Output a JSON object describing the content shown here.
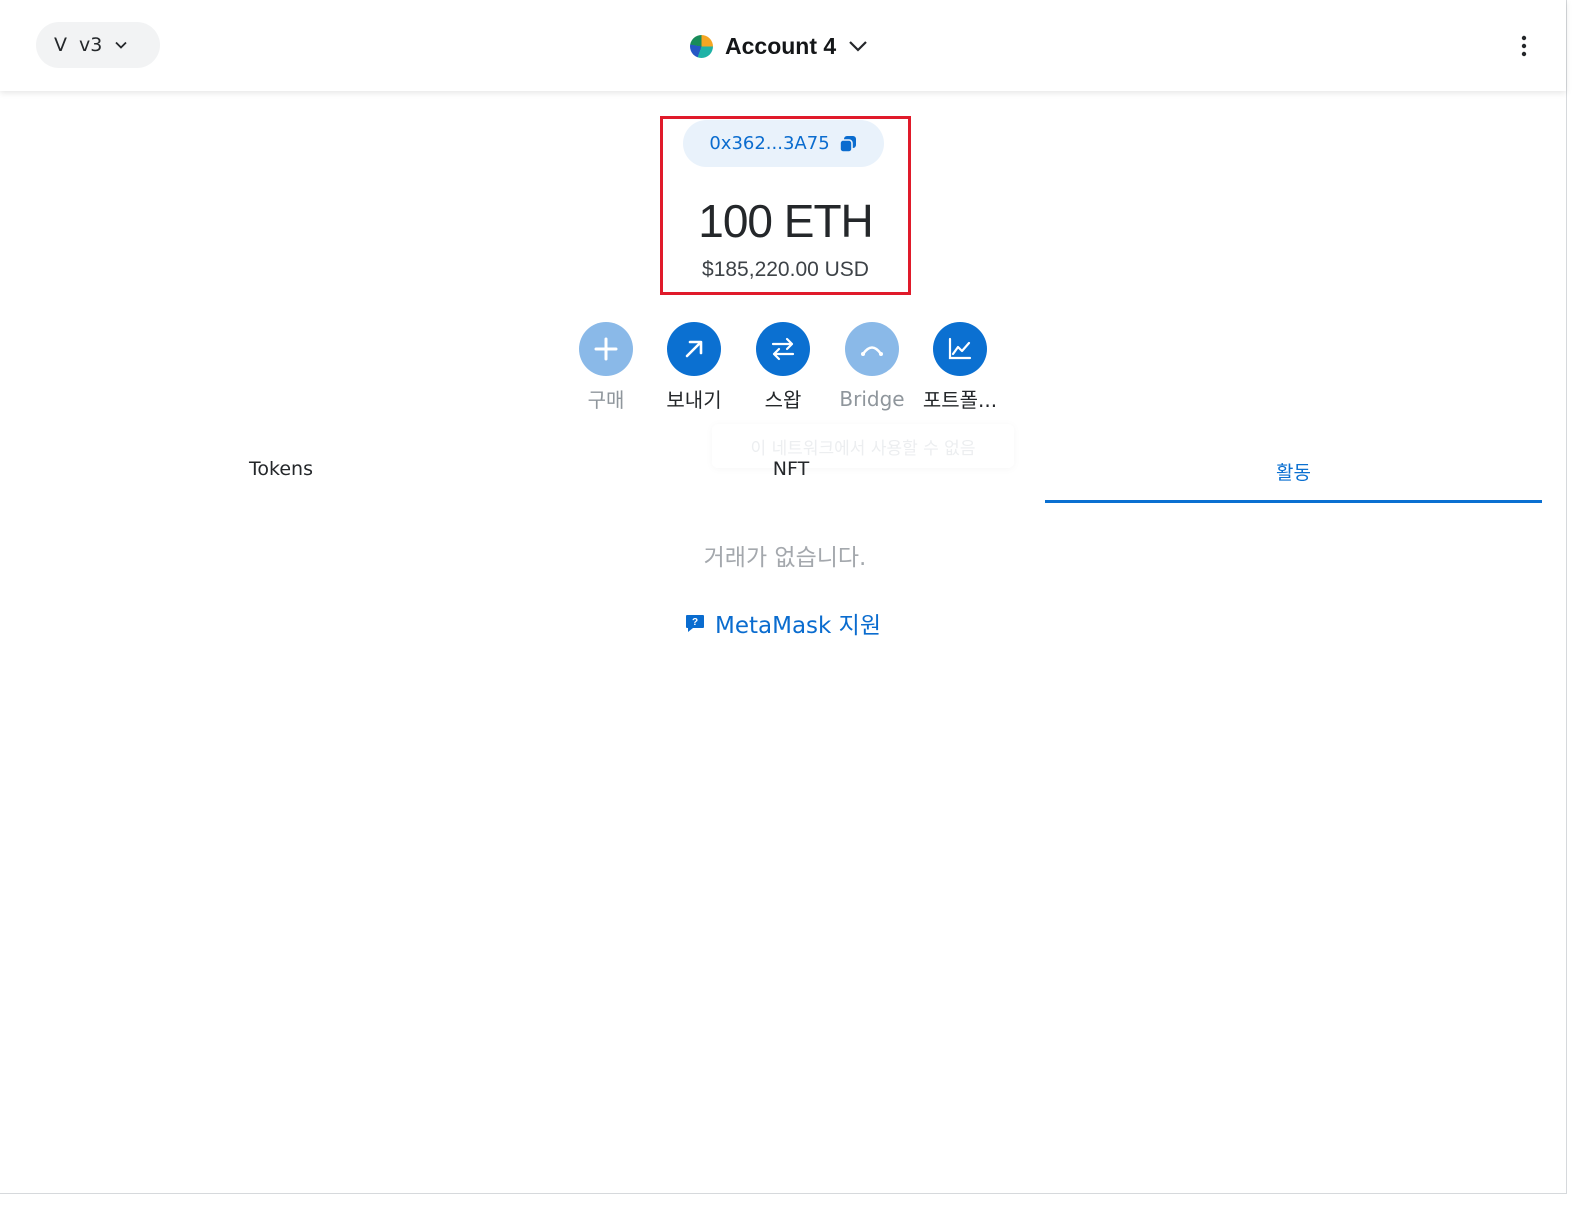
{
  "header": {
    "network_letter": "V",
    "network_name": "v3",
    "account_name": "Account 4"
  },
  "wallet": {
    "address": "0x362...3A75",
    "balance": "100 ETH",
    "fiat_balance": "$185,220.00 USD"
  },
  "actions": [
    {
      "label": "구매",
      "enabled": false,
      "icon": "plus-icon"
    },
    {
      "label": "보내기",
      "enabled": true,
      "icon": "arrow-up-right-icon"
    },
    {
      "label": "스왑",
      "enabled": true,
      "icon": "swap-arrows-icon"
    },
    {
      "label": "Bridge",
      "enabled": false,
      "icon": "bridge-icon"
    },
    {
      "label": "포트폴...",
      "enabled": true,
      "icon": "chart-icon"
    }
  ],
  "tooltip": "이 네트워크에서 사용할 수 없음",
  "tabs": [
    {
      "label": "Tokens",
      "active": false
    },
    {
      "label": "NFT",
      "active": false
    },
    {
      "label": "활동",
      "active": true
    }
  ],
  "activity": {
    "empty_message": "거래가 없습니다.",
    "support_link": "MetaMask 지원"
  },
  "colors": {
    "accent": "#0b70d1",
    "accent_disabled": "#8ab9e8",
    "highlight_box": "#e01a2a"
  }
}
